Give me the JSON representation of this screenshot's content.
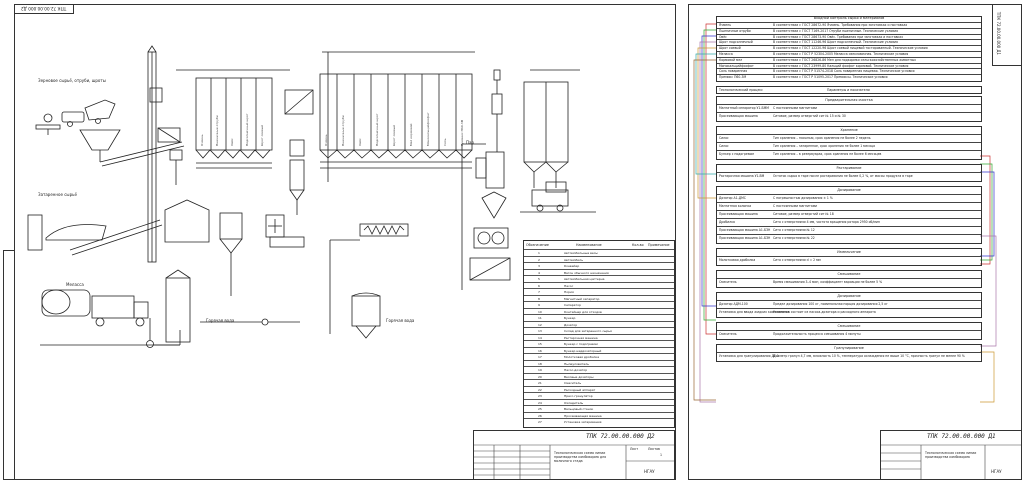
{
  "left_sheet": {
    "stamp": "ТПК 72.00.00.000 Д2",
    "title_block": {
      "code": "ТПК 72.00.00.000 Д2",
      "doc_title": "Технологическая схема линии производства комбикорма для молочного стада",
      "sheet_label": "Лист",
      "sheets_label": "Листов",
      "sheets": "1",
      "org": "НГАУ"
    },
    "flow_labels": {
      "grain": "Зерновое сырьё, отруби, шроты",
      "meal": "Затаренное сырьё",
      "molasses": "Меласса",
      "water": "Горячая вода",
      "water2": "Горячая вода",
      "steam": "Пар"
    },
    "bins1": [
      "Ячмень",
      "Пшеничные отруби",
      "Овёс",
      "Подсолнечный шрот",
      "Шрот соевый"
    ],
    "bins2": [
      "Ячмень",
      "Пшеничные отруби",
      "Овёс",
      "Подсолнечный шрот",
      "Шрот соевый",
      "Мел кормовой",
      "Монокальцийфосфат",
      "Соль",
      "Премикс П60-3М"
    ],
    "legend_header": {
      "pos": "Обозначение",
      "name": "Наименование",
      "qty": "Кол-во",
      "note": "Примечание"
    },
    "legend": [
      {
        "n": "1",
        "name": "Автомобильные весы"
      },
      {
        "n": "2",
        "name": "Автомобиль"
      },
      {
        "n": "3",
        "name": "Конвейер"
      },
      {
        "n": "4",
        "name": "Вагон обычного назначения"
      },
      {
        "n": "5",
        "name": "Автомобильная цистерна"
      },
      {
        "n": "6",
        "name": "Насос"
      },
      {
        "n": "7",
        "name": "Нория"
      },
      {
        "n": "8",
        "name": "Магнитный сепаратор"
      },
      {
        "n": "9",
        "name": "Сепаратор"
      },
      {
        "n": "10",
        "name": "Контейнер для отходов"
      },
      {
        "n": "11",
        "name": "Бункер"
      },
      {
        "n": "12",
        "name": "Дозатор"
      },
      {
        "n": "13",
        "name": "Склад для затаренного сырья"
      },
      {
        "n": "14",
        "name": "Растарочная машина"
      },
      {
        "n": "15",
        "name": "Бункер с подогревом"
      },
      {
        "n": "16",
        "name": "Бункер наддозаторный"
      },
      {
        "n": "17",
        "name": "Молотковая дробилка"
      },
      {
        "n": "18",
        "name": "Пылеуловитель"
      },
      {
        "n": "19",
        "name": "Насос-дозатор"
      },
      {
        "n": "20",
        "name": "Весовые дозаторы"
      },
      {
        "n": "21",
        "name": "Смеситель"
      },
      {
        "n": "22",
        "name": "Расходный аппарат"
      },
      {
        "n": "23",
        "name": "Пресс-гранулятор"
      },
      {
        "n": "24",
        "name": "Охладитель"
      },
      {
        "n": "25",
        "name": "Вальцовый станок"
      },
      {
        "n": "26",
        "name": "Просеивающая машина"
      },
      {
        "n": "27",
        "name": "Установка затаривания"
      }
    ]
  },
  "right_sheet": {
    "stamp": "ТПК 72.00.00.000 Д1",
    "title_block": {
      "code": "ТПК 72.00.00.000 Д1",
      "doc_title": "Технологическая схема линии производства комбикорма",
      "org": "НГАУ"
    },
    "incoming_header": "Входной контроль сырья и материалов",
    "incoming": [
      {
        "name": "Ячмень",
        "spec": "В соответствии с ГОСТ 28672-90 Ячмень. Требования при заготовках и поставках"
      },
      {
        "name": "Пшеничные отруби",
        "spec": "В соответствии с ГОСТ 7169-2017 Отруби пшеничные. Технические условия"
      },
      {
        "name": "Овёс",
        "spec": "В соответствии с ГОСТ 28673-90 Овёс. Требования при заготовках и поставках"
      },
      {
        "name": "Шрот подсолнечный",
        "spec": "В соответствии с ГОСТ 11246-96 Шрот подсолнечный. Технические условия"
      },
      {
        "name": "Шрот соевый",
        "spec": "В соответствии с ГОСТ 12220-96 Шрот соевый пищевой тостированный. Технические условия"
      },
      {
        "name": "Меласса",
        "spec": "В соответствии с ГОСТ Р 52304-2005 Меласса свекловичная. Технические условия"
      },
      {
        "name": "Кормовой мел",
        "spec": "В соответствии с ГОСТ 26826-86 Мел для подкормки сельскохозяйственных животных"
      },
      {
        "name": "Монокальцийфосфат",
        "spec": "В соответствии с ГОСТ 23999-80 Кальций фосфат кормовой. Технические условия"
      },
      {
        "name": "Соль поваренная",
        "spec": "В соответствии с ГОСТ Р 51574-2018 Соль поваренная пищевая. Технические условия"
      },
      {
        "name": "Премикс П60-3М",
        "spec": "В соответствии с ГОСТ Р 51095-2017 Премиксы. Технические условия"
      }
    ],
    "process_header": {
      "left": "Технологический процесс",
      "right": "Параметры и показатели"
    },
    "sections": [
      {
        "title": "Предварительная очистка",
        "rows": [
          {
            "name": "Магнитный сепаратор У1-БММ",
            "spec": "С постоянными магнитами"
          },
          {
            "name": "Просеивающая машина",
            "spec": "Ситовое, размер отверстий сит № 15 и № 30"
          }
        ]
      },
      {
        "title": "Хранение",
        "rows": [
          {
            "name": "Силос",
            "spec": "Тип хранения – насыпью, срок хранения не более 2 недель"
          },
          {
            "name": "Силос",
            "spec": "Тип хранения – затаренное, срок хранения не более 1 месяца"
          },
          {
            "name": "Бункер с подогревом",
            "spec": "Тип хранения – в резервуарах, срок хранения не более 6 месяцев"
          }
        ]
      },
      {
        "title": "Растаривание",
        "rows": [
          {
            "name": "Растарочная машина У1-ВМ",
            "spec": "Остаток сырья в таре после растаривания не более 0,2 %, от массы продукта в таре"
          }
        ]
      },
      {
        "title": "Дозирование",
        "rows": [
          {
            "name": "Дозатор А1-ДМС",
            "spec": "С погрешностью дозирования ± 1 %"
          },
          {
            "name": "Магнитная колонка",
            "spec": "С постоянными магнитами"
          },
          {
            "name": "Просеивающая машина",
            "spec": "Ситовое, размер отверстий сит № 18"
          },
          {
            "name": "Дробилка",
            "spec": "Сито с отверстиями 4 мм, частота вращения ротора 2950 об/мин"
          },
          {
            "name": "Просеивающая машина А1-БЗН",
            "spec": "Сито с отверстиями № 12"
          },
          {
            "name": "Просеивающая машина А1-БЗН",
            "spec": "Сито с отверстиями № 22"
          }
        ]
      },
      {
        "title": "Измельчение",
        "rows": [
          {
            "name": "Молотковая дробилка",
            "spec": "Сито с отверстиями d = 2 мм"
          }
        ]
      },
      {
        "title": "Смешивание",
        "rows": [
          {
            "name": "Смеситель",
            "spec": "Время смешивания 3–4 мин, коэффициент вариации не более 5 %"
          }
        ]
      },
      {
        "title": "Дозирование",
        "rows": [
          {
            "name": "Дозатор АДМ-100",
            "spec": "Предел дозирования 100 кг, номинальная порция дозирования 2,5 кг"
          },
          {
            "name": "Установка для ввода жидких компонентов",
            "spec": "Установка состоит из насоса-дозатора и расходного аппарата"
          }
        ]
      },
      {
        "title": "Смешивание",
        "rows": [
          {
            "name": "Смеситель",
            "spec": "Продолжительность процесса смешивания 4 минуты"
          }
        ]
      },
      {
        "title": "Гранулирование",
        "rows": [
          {
            "name": "Установка для гранулирования ДГ-1",
            "spec": "Диаметр гранул 4,7 мм, влажность 10 %, температура охлаждения не выше 10 °С, прочность гранул не менее 90 %"
          }
        ]
      }
    ]
  }
}
